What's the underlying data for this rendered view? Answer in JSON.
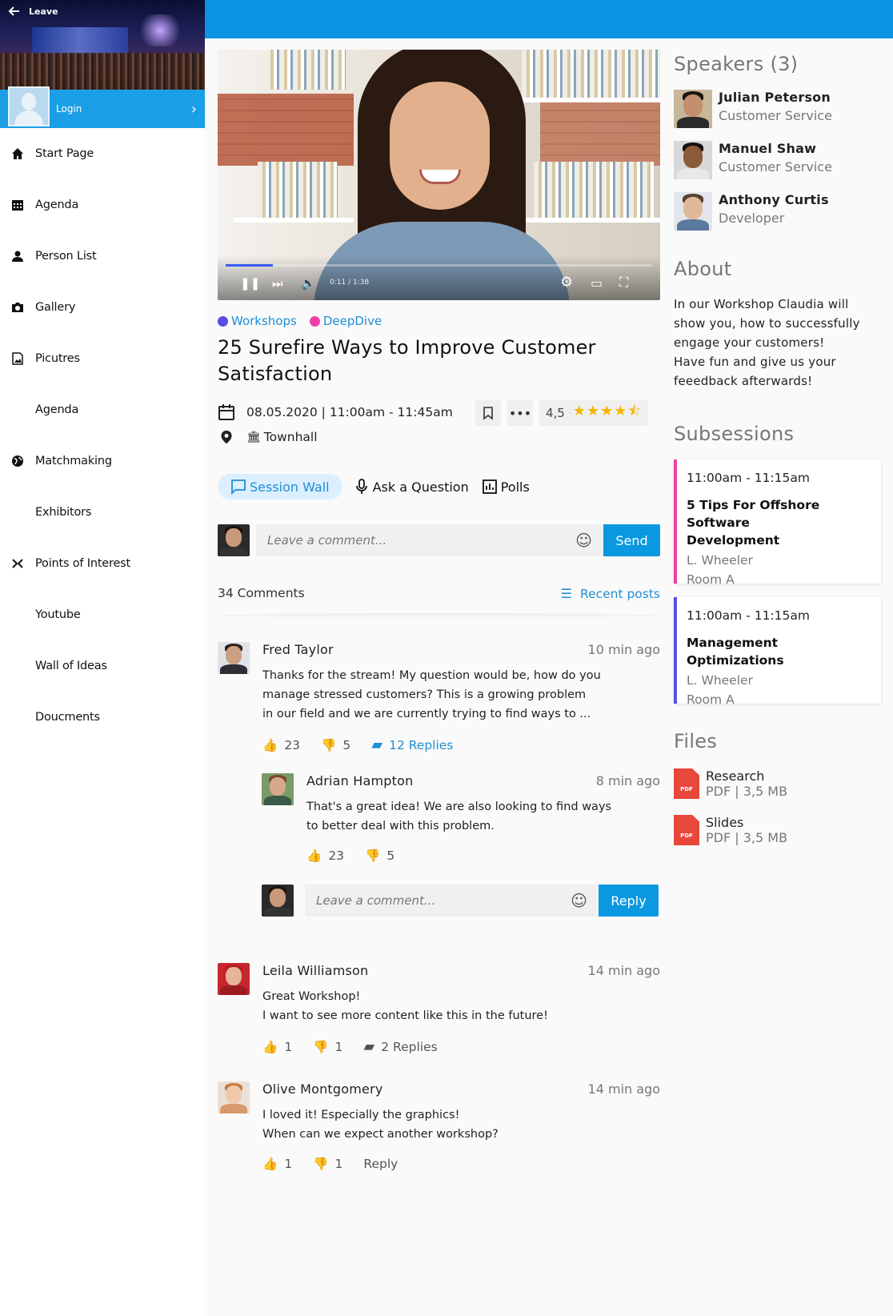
{
  "sidebar": {
    "leave_label": "Leave",
    "login_label": "Login",
    "items": [
      {
        "label": "Start Page",
        "icon": "home-icon"
      },
      {
        "label": "Agenda",
        "icon": "calendar-grid-icon"
      },
      {
        "label": "Person List",
        "icon": "person-icon"
      },
      {
        "label": "Gallery",
        "icon": "camera-icon"
      },
      {
        "label": "Picutres",
        "icon": "image-icon"
      },
      {
        "label": "Agenda",
        "icon": ""
      },
      {
        "label": "Matchmaking",
        "icon": "globe-icon"
      },
      {
        "label": "Exhibitors",
        "icon": ""
      },
      {
        "label": "Points of Interest",
        "icon": "arrows-icon"
      },
      {
        "label": "Youtube",
        "icon": ""
      },
      {
        "label": "Wall of Ideas",
        "icon": ""
      },
      {
        "label": "Doucments",
        "icon": ""
      }
    ]
  },
  "video": {
    "time": "0:11 / 1:38",
    "progress": 0.11
  },
  "session": {
    "tags": [
      {
        "label": "Workshops",
        "color": "#5a4de6"
      },
      {
        "label": "DeepDive",
        "color": "#ee3fa8"
      }
    ],
    "title": "25 Surefire Ways to Improve Customer Satisfaction",
    "datetime": "08.05.2020 | 11:00am - 11:45am",
    "location": "Townhall",
    "rating": "4,5",
    "stars": 4.5
  },
  "tabs": [
    {
      "label": "Session Wall",
      "active": true
    },
    {
      "label": "Ask a Question",
      "active": false
    },
    {
      "label": "Polls",
      "active": false
    }
  ],
  "comment_input": {
    "placeholder": "Leave a comment...",
    "send_label": "Send"
  },
  "comments_head": {
    "count": "34 Comments",
    "sort_label": "Recent posts"
  },
  "comments": [
    {
      "name": "Fred Taylor",
      "time": "10 min ago",
      "lines": [
        "Thanks for the stream! My question would be, how do you",
        "manage stressed customers? This is a growing problem",
        "in our field and we are currently trying to find ways to ..."
      ],
      "likes": "23",
      "dislikes": "5",
      "replies": "12 Replies"
    },
    {
      "name": "Adrian Hampton",
      "time": "8 min ago",
      "lines": [
        "That's a great idea! We are also looking to find ways",
        "to better deal with this problem."
      ],
      "likes": "23",
      "dislikes": "5"
    },
    {
      "name": "Leila Williamson",
      "time": "14 min ago",
      "lines": [
        "Great Workshop!",
        "I want to see more content like this in the future!"
      ],
      "likes": "1",
      "dislikes": "1",
      "replies": "2 Replies"
    },
    {
      "name": "Olive Montgomery",
      "time": "14 min ago",
      "lines": [
        "I loved it! Especially the graphics!",
        "When can we expect another workshop?"
      ],
      "likes": "1",
      "dislikes": "1",
      "reply_label": "Reply"
    }
  ],
  "reply_input": {
    "placeholder": "Leave a comment...",
    "reply_label": "Reply"
  },
  "speakers": {
    "title": "Speakers (3)",
    "list": [
      {
        "name": "Julian Peterson",
        "role": "Customer Service"
      },
      {
        "name": "Manuel Shaw",
        "role": "Customer Service"
      },
      {
        "name": "Anthony Curtis",
        "role": "Developer"
      }
    ]
  },
  "about": {
    "title": "About",
    "lines": [
      "In our Workshop Claudia will",
      "show you, how to successfully",
      "engage your customers!",
      "Have fun and give us your",
      "feeedback afterwards!"
    ]
  },
  "subsessions": {
    "title": "Subsessions",
    "list": [
      {
        "time": "11:00am - 11:15am",
        "title_lines": [
          "5 Tips For Offshore Software",
          "Development"
        ],
        "speaker": "L. Wheeler",
        "room": "Room A",
        "color": "#ee3fa8"
      },
      {
        "time": "11:00am - 11:15am",
        "title_lines": [
          "Management Optimizations"
        ],
        "speaker": "L. Wheeler",
        "room": "Room A",
        "color": "#5a4de6"
      }
    ]
  },
  "files": {
    "title": "Files",
    "pdf_badge": "PDF",
    "list": [
      {
        "name": "Research",
        "meta": "PDF | 3,5 MB"
      },
      {
        "name": "Slides",
        "meta": "PDF | 3,5 MB"
      }
    ]
  },
  "colors": {
    "accent": "#0a98e0",
    "topbar": "#0a93e0",
    "link": "#1f8fd6",
    "star": "#f5b400"
  }
}
